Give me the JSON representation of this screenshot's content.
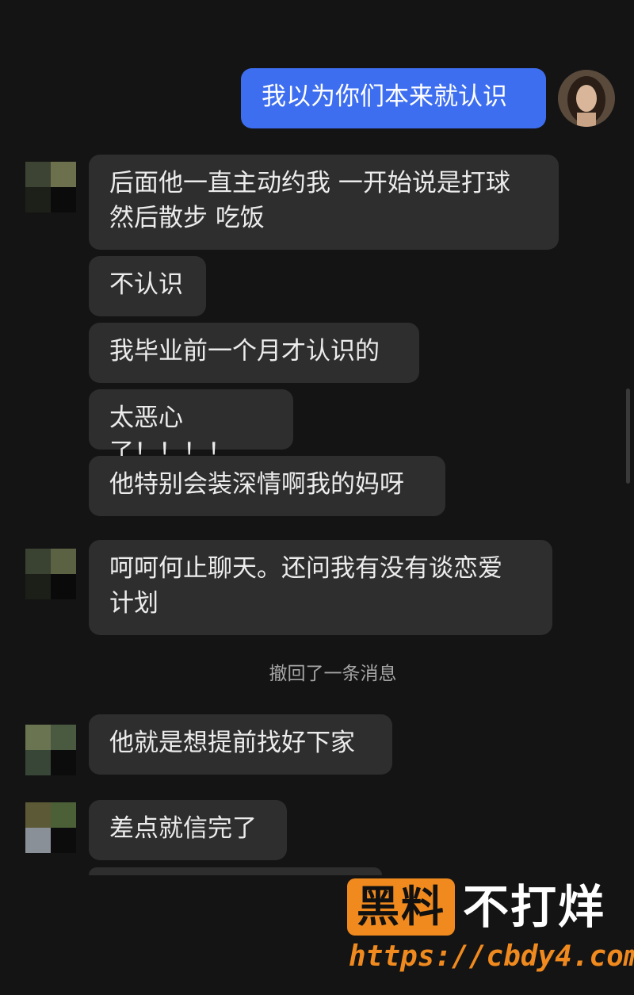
{
  "messages": [
    {
      "sender": "me",
      "text": "我以为你们本来就认识"
    },
    {
      "sender": "them",
      "text": "后面他一直主动约我 一开始说是打球\n然后散步 吃饭"
    },
    {
      "sender": "them",
      "text": "不认识"
    },
    {
      "sender": "them",
      "text": "我毕业前一个月才认识的"
    },
    {
      "sender": "them",
      "text": "太恶心了！！！！"
    },
    {
      "sender": "them",
      "text": "他特别会装深情啊我的妈呀"
    },
    {
      "sender": "them",
      "text": "呵呵何止聊天。还问我有没有谈恋爱\n计划"
    },
    {
      "sender": "them",
      "text": "他就是想提前找好下家"
    },
    {
      "sender": "them",
      "text": "差点就信完了"
    }
  ],
  "system_notice": "撤回了一条消息",
  "watermark": {
    "box_text": "黑料",
    "text": "不打烊",
    "url": "https://cbdy4.com"
  },
  "colors": {
    "background": "#141414",
    "incoming_bubble": "#2e2e2e",
    "outgoing_bubble": "#3e6ef0",
    "watermark_accent": "#f08a1e"
  }
}
